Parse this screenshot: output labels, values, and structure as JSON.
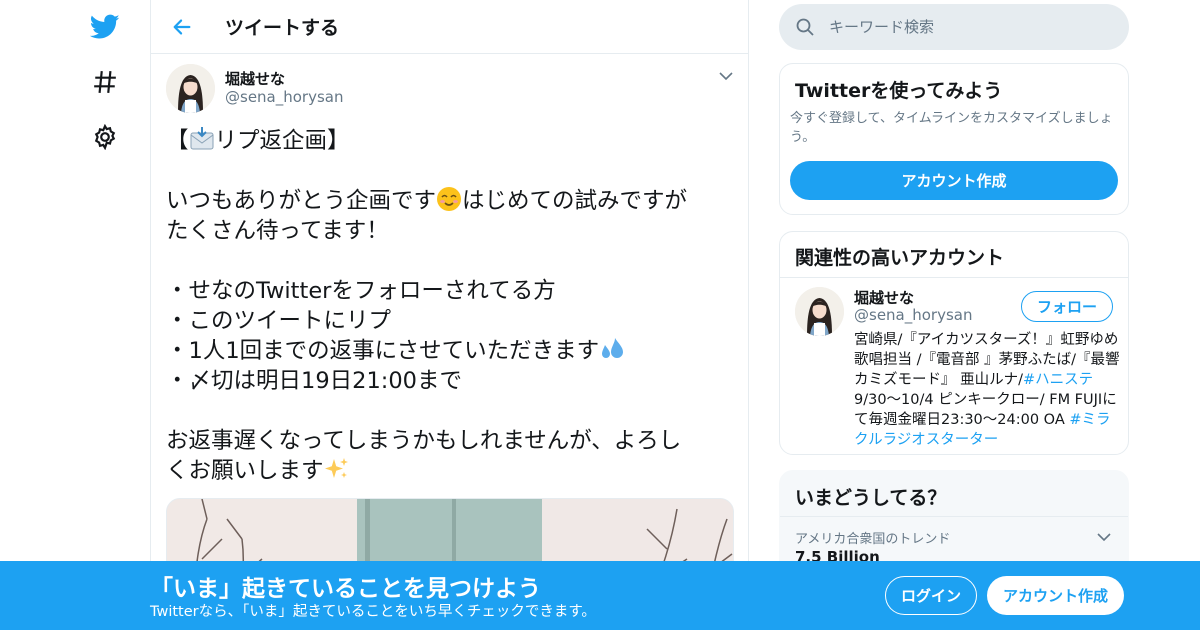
{
  "theme": {
    "accent": "#1da1f2",
    "border": "#e6ecf0",
    "muted": "#657786"
  },
  "nav": {
    "icons": [
      "twitter-logo-icon",
      "hashtag-icon",
      "gear-icon"
    ]
  },
  "header": {
    "title": "ツイートする"
  },
  "tweet": {
    "author_name": "堀越せな",
    "author_handle": "@sena_horysan",
    "lines": {
      "l1a": "【",
      "l1b": "リプ返企画】",
      "l3a": "いつもありがとう企画です",
      "l3b": "はじめての試みですが",
      "l4": "たくさん待ってます！",
      "l6": "・せなのTwitterをフォローされてる方",
      "l7": "・このツイートにリプ",
      "l8": "・1人1回までの返事にさせていただきます",
      "l9": "・〆切は明日19日21:00まで",
      "l11": "お返事遅くなってしまうかもしれませんが、よろし",
      "l12": "くお願いします"
    }
  },
  "search": {
    "placeholder": "キーワード検索"
  },
  "signup_card": {
    "title": "Twitterを使ってみよう",
    "description": "今すぐ登録して、タイムラインをカスタマイズしましょう。",
    "button": "アカウント作成"
  },
  "related": {
    "title": "関連性の高いアカウント",
    "name": "堀越せな",
    "handle": "@sena_horysan",
    "follow": "フォロー",
    "bio_1": "宮崎県/『アイカツスターズ！』虹野ゆめ歌唱担当 /『電音部 』茅野ふたば/『最響カミズモード』 亜山ルナ/",
    "bio_link_1": "#ハニステ",
    "bio_2": " 9/30〜10/4 ピンキークロー/ FM FUJIにて毎週金曜日23:30〜24:00 OA ",
    "bio_link_2": "#ミラクルラジオスターター"
  },
  "trends": {
    "title": "いまどうしてる？",
    "meta": "アメリカ合衆国のトレンド",
    "name": "7.5 Billion"
  },
  "banner": {
    "title": "「いま」起きていることを見つけよう",
    "subtitle": "Twitterなら、「いま」起きていることをいち早くチェックできます。",
    "login": "ログイン",
    "signup": "アカウント作成"
  }
}
